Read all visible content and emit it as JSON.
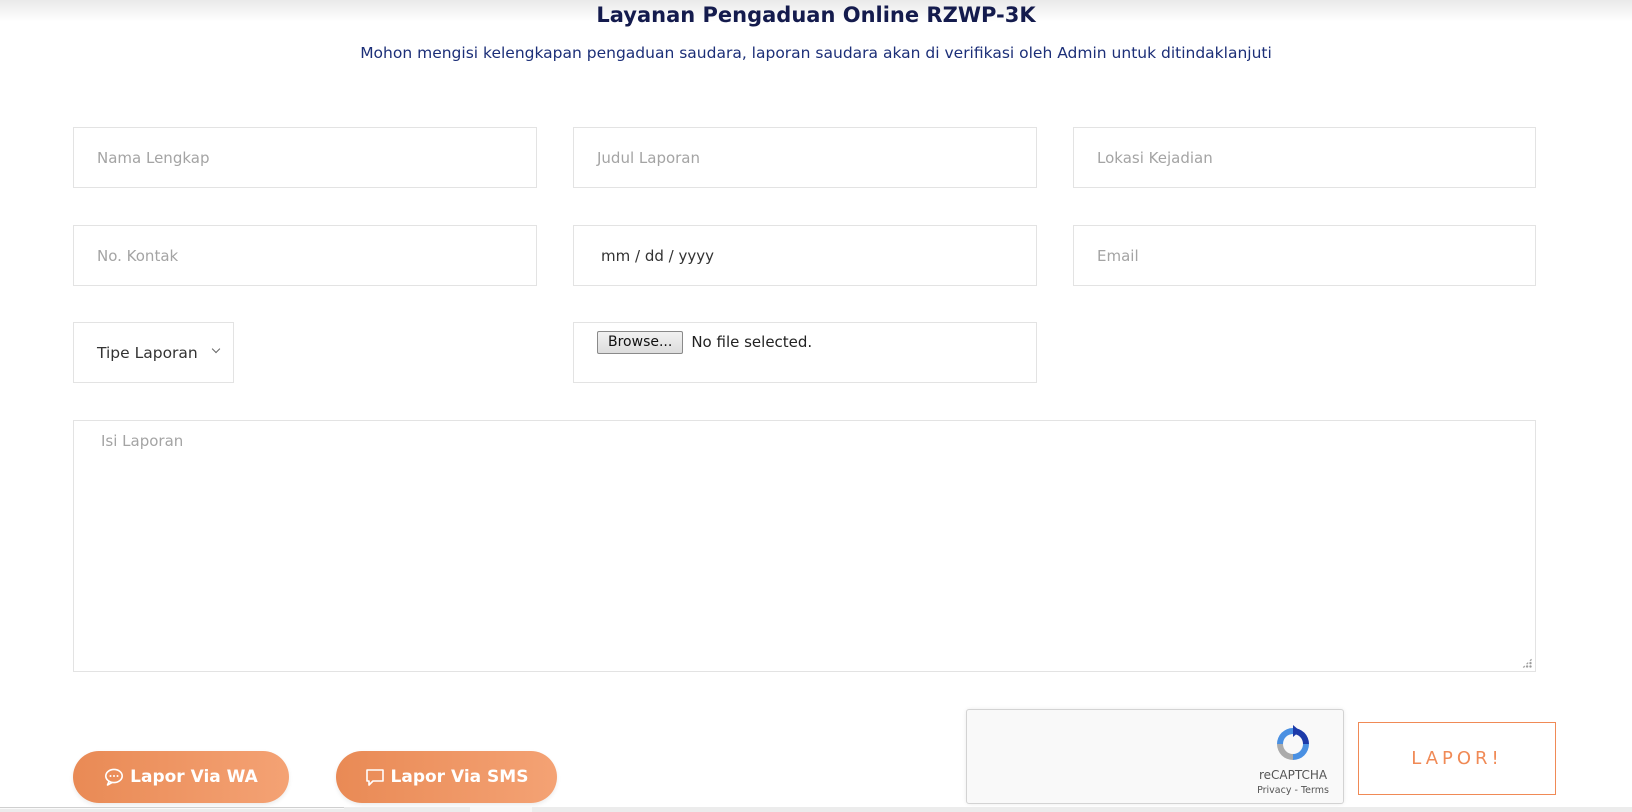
{
  "header": {
    "title": "Layanan Pengaduan Online RZWP-3K",
    "subtitle": "Mohon mengisi kelengkapan pengaduan saudara, laporan saudara akan di verifikasi oleh Admin untuk ditindaklanjuti"
  },
  "form": {
    "nama_placeholder": "Nama Lengkap",
    "judul_placeholder": "Judul Laporan",
    "lokasi_placeholder": "Lokasi Kejadian",
    "kontak_placeholder": "No. Kontak",
    "tanggal_placeholder": "mm / dd / yyyy",
    "email_placeholder": "Email",
    "tipe_selected": "Tipe Laporan",
    "file_browse_label": "Browse...",
    "file_status": "No file selected.",
    "isi_placeholder": "Isi Laporan"
  },
  "actions": {
    "wa_label": "Lapor Via WA",
    "sms_label": "Lapor Via SMS",
    "submit_label": "LAPOR!"
  },
  "captcha": {
    "label": "reCAPTCHA",
    "links": "Privacy - Terms"
  },
  "colors": {
    "accent": "#f08a56",
    "title": "#141b4d",
    "subtitle": "#1c2f78"
  },
  "icons": {
    "wa": "chat-bubble-icon",
    "sms": "message-bubble-icon",
    "select": "chevron-down-icon",
    "captcha": "recaptcha-logo-icon"
  }
}
